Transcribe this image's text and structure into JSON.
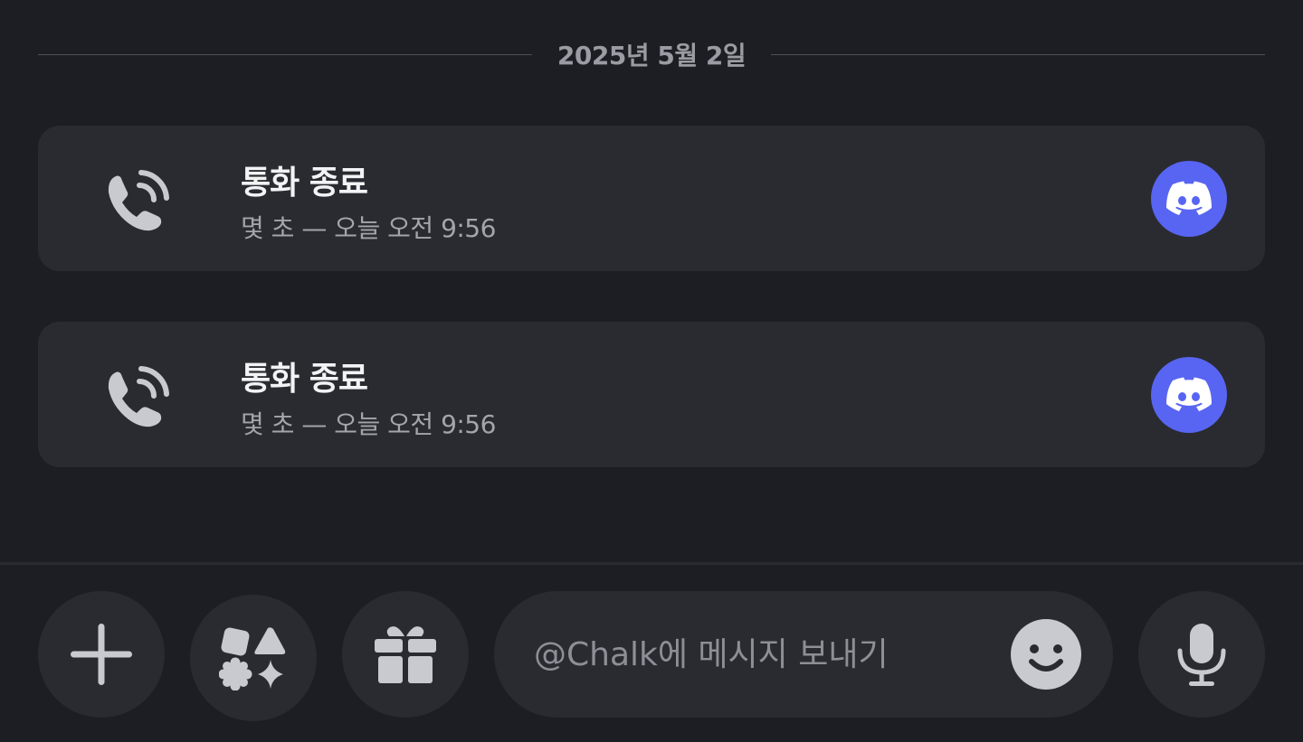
{
  "date_divider": {
    "label": "2025년 5월 2일"
  },
  "calls": [
    {
      "title": "통화 종료",
      "meta": "몇 초 — 오늘 오전 9:56",
      "icon": "phone-call-icon",
      "badge_icon": "discord-logo-icon"
    },
    {
      "title": "통화 종료",
      "meta": "몇 초 — 오늘 오전 9:56",
      "icon": "phone-call-icon",
      "badge_icon": "discord-logo-icon"
    }
  ],
  "composer": {
    "placeholder": "@Chalk에 메시지 보내기",
    "value": "",
    "buttons": {
      "add": "plus-icon",
      "apps": "apps-icon",
      "gift": "gift-icon",
      "emoji": "emoji-icon",
      "voice": "microphone-icon"
    }
  },
  "colors": {
    "background": "#1d1e23",
    "card": "#2a2b30",
    "accent": "#5865f2",
    "icon": "#c9cad0",
    "muted_text": "#9b9ca3"
  }
}
